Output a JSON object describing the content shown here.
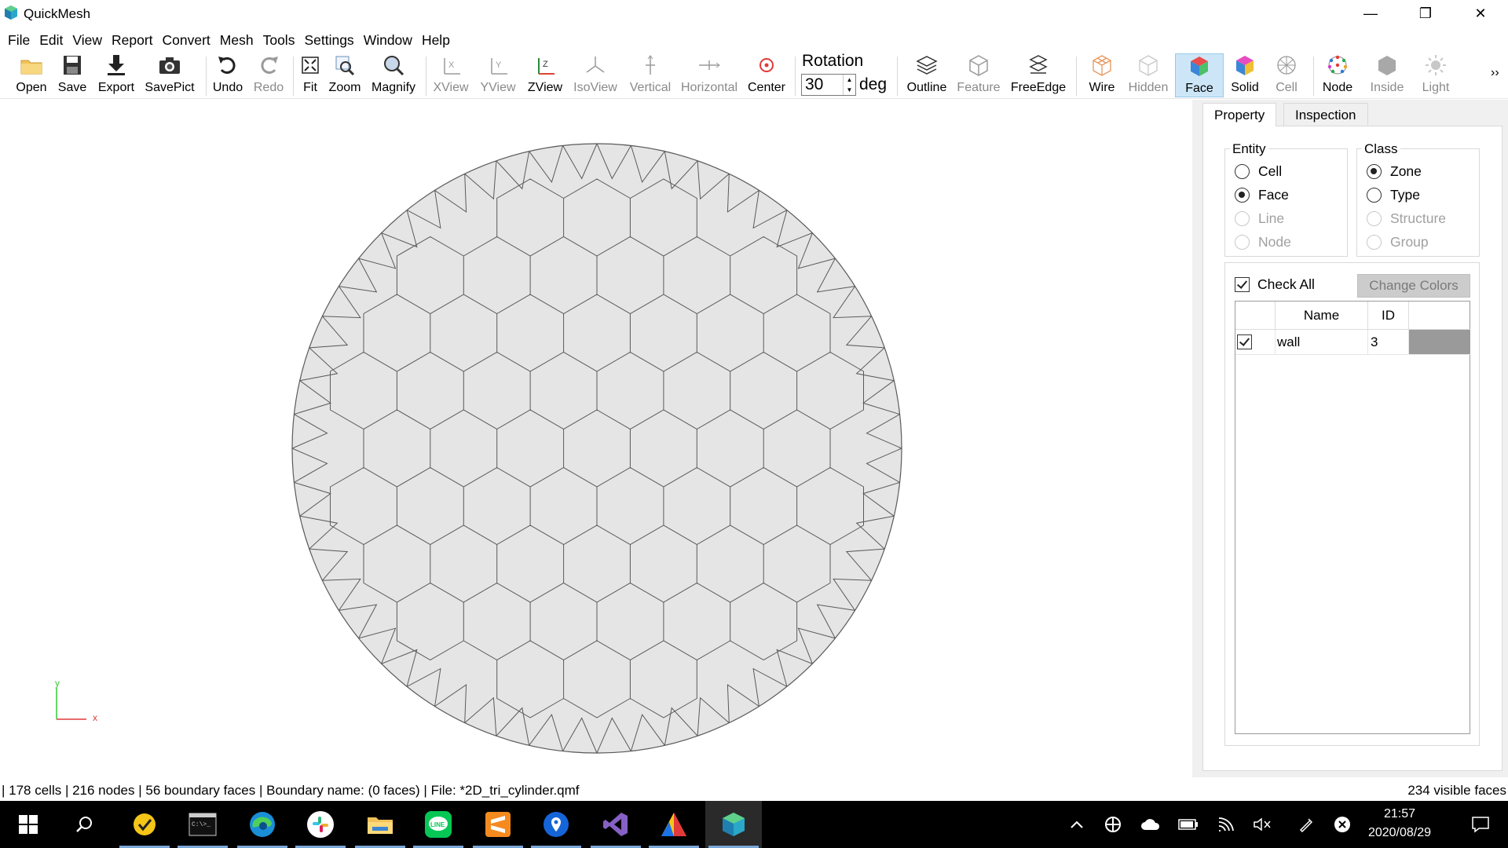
{
  "window": {
    "title": "QuickMesh",
    "minimize": "—",
    "restore": "❐",
    "close": "✕"
  },
  "menu": [
    "File",
    "Edit",
    "View",
    "Report",
    "Convert",
    "Mesh",
    "Tools",
    "Settings",
    "Window",
    "Help"
  ],
  "toolbar": {
    "open": "Open",
    "save": "Save",
    "export": "Export",
    "savepict": "SavePict",
    "undo": "Undo",
    "redo": "Redo",
    "fit": "Fit",
    "zoom": "Zoom",
    "magnify": "Magnify",
    "xview": "XView",
    "yview": "YView",
    "zview": "ZView",
    "isoview": "IsoView",
    "vertical": "Vertical",
    "horizontal": "Horizontal",
    "center": "Center",
    "rotation_label": "Rotation",
    "rotation_value": "30",
    "rotation_unit": "deg",
    "outline": "Outline",
    "feature": "Feature",
    "freeedge": "FreeEdge",
    "wire": "Wire",
    "hidden": "Hidden",
    "face": "Face",
    "solid": "Solid",
    "cell": "Cell",
    "node": "Node",
    "inside": "Inside",
    "light": "Light",
    "overflow": "››"
  },
  "axes": {
    "y": "y",
    "x": "x"
  },
  "panel": {
    "tabs": [
      "Property",
      "Inspection"
    ],
    "entity": {
      "title": "Entity",
      "options": [
        "Cell",
        "Face",
        "Line",
        "Node"
      ],
      "selected": "Face"
    },
    "class": {
      "title": "Class",
      "options": [
        "Zone",
        "Type",
        "Structure",
        "Group"
      ],
      "selected": "Zone"
    },
    "check_all": "Check All",
    "change_colors": "Change Colors",
    "table": {
      "headers": [
        "Name",
        "ID"
      ],
      "rows": [
        {
          "checked": true,
          "name": "wall",
          "id": "3",
          "color": "#9a9a9a"
        }
      ]
    }
  },
  "status": {
    "left": "| 178 cells | 216 nodes | 56 boundary faces |  Boundary name:  (0 faces) | File: *2D_tri_cylinder.qmf",
    "right": "234 visible faces"
  },
  "clock": {
    "time": "21:57",
    "date": "2020/08/29"
  },
  "colors": {
    "mesh_fill": "#e5e5e5",
    "mesh_edge": "#5a5a5a",
    "axis_y": "#33cc33",
    "axis_x": "#e23a3a",
    "active_button": "#cde6f7"
  }
}
